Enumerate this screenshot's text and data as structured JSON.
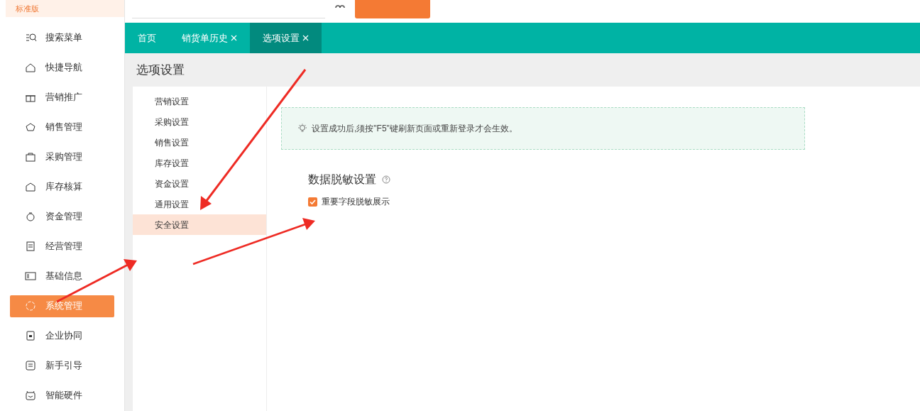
{
  "edition_badge": "标准版",
  "sidebar": {
    "items": [
      {
        "label": "搜索菜单",
        "selected": false
      },
      {
        "label": "快捷导航",
        "selected": false
      },
      {
        "label": "营销推广",
        "selected": false
      },
      {
        "label": "销售管理",
        "selected": false
      },
      {
        "label": "采购管理",
        "selected": false
      },
      {
        "label": "库存核算",
        "selected": false
      },
      {
        "label": "资金管理",
        "selected": false
      },
      {
        "label": "经营管理",
        "selected": false
      },
      {
        "label": "基础信息",
        "selected": false
      },
      {
        "label": "系统管理",
        "selected": true
      },
      {
        "label": "企业协同",
        "selected": false
      },
      {
        "label": "新手引导",
        "selected": false
      },
      {
        "label": "智能硬件",
        "selected": false
      }
    ]
  },
  "tabs": [
    {
      "label": "首页",
      "selected": false,
      "closable": false
    },
    {
      "label": "销货单历史",
      "selected": false,
      "closable": true
    },
    {
      "label": "选项设置",
      "selected": true,
      "closable": true
    }
  ],
  "page_title": "选项设置",
  "settings_menu": [
    {
      "label": "营销设置",
      "selected": false
    },
    {
      "label": "采购设置",
      "selected": false
    },
    {
      "label": "销售设置",
      "selected": false
    },
    {
      "label": "库存设置",
      "selected": false
    },
    {
      "label": "资金设置",
      "selected": false
    },
    {
      "label": "通用设置",
      "selected": false
    },
    {
      "label": "安全设置",
      "selected": true
    }
  ],
  "notice": "设置成功后,须按\"F5\"键刷新页面或重新登录才会生效。",
  "section": {
    "title": "数据脱敏设置",
    "options": [
      {
        "label": "重要字段脱敏展示",
        "checked": true
      }
    ]
  }
}
